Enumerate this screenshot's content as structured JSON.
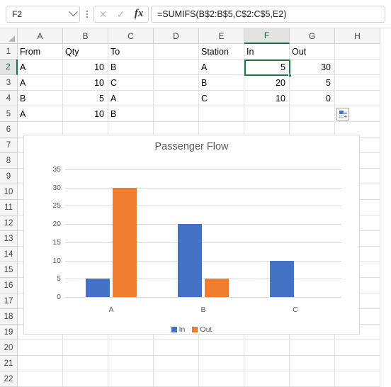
{
  "formula_bar": {
    "name_box": "F2",
    "formula": "=SUMIFS(B$2:B$5,C$2:C$5,E2)",
    "cancel_icon": "close-icon",
    "confirm_icon": "check-icon",
    "function_icon": "fx-icon",
    "dropdown_icon": "chevron-down-icon",
    "more_icon": "kebab-menu-icon"
  },
  "grid": {
    "columns": [
      "A",
      "B",
      "C",
      "D",
      "E",
      "F",
      "G",
      "H"
    ],
    "active_column": "F",
    "active_row": 2,
    "rows": [
      1,
      2,
      3,
      4,
      5,
      6,
      7,
      8,
      9,
      10,
      11,
      12,
      13,
      14,
      15,
      16,
      17,
      18,
      19,
      20,
      21,
      22
    ],
    "cells": [
      {
        "col": "A",
        "row": 1,
        "value": "From",
        "align": "left"
      },
      {
        "col": "B",
        "row": 1,
        "value": "Qty",
        "align": "left"
      },
      {
        "col": "C",
        "row": 1,
        "value": "To",
        "align": "left"
      },
      {
        "col": "E",
        "row": 1,
        "value": "Station",
        "align": "left"
      },
      {
        "col": "F",
        "row": 1,
        "value": "In",
        "align": "left"
      },
      {
        "col": "G",
        "row": 1,
        "value": "Out",
        "align": "left"
      },
      {
        "col": "A",
        "row": 2,
        "value": "A",
        "align": "left"
      },
      {
        "col": "B",
        "row": 2,
        "value": "10",
        "align": "right"
      },
      {
        "col": "C",
        "row": 2,
        "value": "B",
        "align": "left"
      },
      {
        "col": "E",
        "row": 2,
        "value": "A",
        "align": "left"
      },
      {
        "col": "F",
        "row": 2,
        "value": "5",
        "align": "right"
      },
      {
        "col": "G",
        "row": 2,
        "value": "30",
        "align": "right"
      },
      {
        "col": "A",
        "row": 3,
        "value": "A",
        "align": "left"
      },
      {
        "col": "B",
        "row": 3,
        "value": "10",
        "align": "right"
      },
      {
        "col": "C",
        "row": 3,
        "value": "C",
        "align": "left"
      },
      {
        "col": "E",
        "row": 3,
        "value": "B",
        "align": "left"
      },
      {
        "col": "F",
        "row": 3,
        "value": "20",
        "align": "right"
      },
      {
        "col": "G",
        "row": 3,
        "value": "5",
        "align": "right"
      },
      {
        "col": "A",
        "row": 4,
        "value": "B",
        "align": "left"
      },
      {
        "col": "B",
        "row": 4,
        "value": "5",
        "align": "right"
      },
      {
        "col": "C",
        "row": 4,
        "value": "A",
        "align": "left"
      },
      {
        "col": "E",
        "row": 4,
        "value": "C",
        "align": "left"
      },
      {
        "col": "F",
        "row": 4,
        "value": "10",
        "align": "right"
      },
      {
        "col": "G",
        "row": 4,
        "value": "0",
        "align": "right"
      },
      {
        "col": "A",
        "row": 5,
        "value": "A",
        "align": "left"
      },
      {
        "col": "B",
        "row": 5,
        "value": "10",
        "align": "right"
      },
      {
        "col": "C",
        "row": 5,
        "value": "B",
        "align": "left"
      }
    ],
    "selected_cell": "F2",
    "quick_analysis_icon": "quick-analysis-icon"
  },
  "chart_data": {
    "type": "bar",
    "title": "Passenger Flow",
    "categories": [
      "A",
      "B",
      "C"
    ],
    "series": [
      {
        "name": "In",
        "values": [
          5,
          20,
          10
        ],
        "color": "#4472C4"
      },
      {
        "name": "Out",
        "values": [
          30,
          5,
          0
        ],
        "color": "#ED7D31"
      }
    ],
    "xlabel": "",
    "ylabel": "",
    "ylim": [
      0,
      35
    ],
    "yticks": [
      0,
      5,
      10,
      15,
      20,
      25,
      30,
      35
    ],
    "grid": true,
    "legend_position": "bottom"
  }
}
